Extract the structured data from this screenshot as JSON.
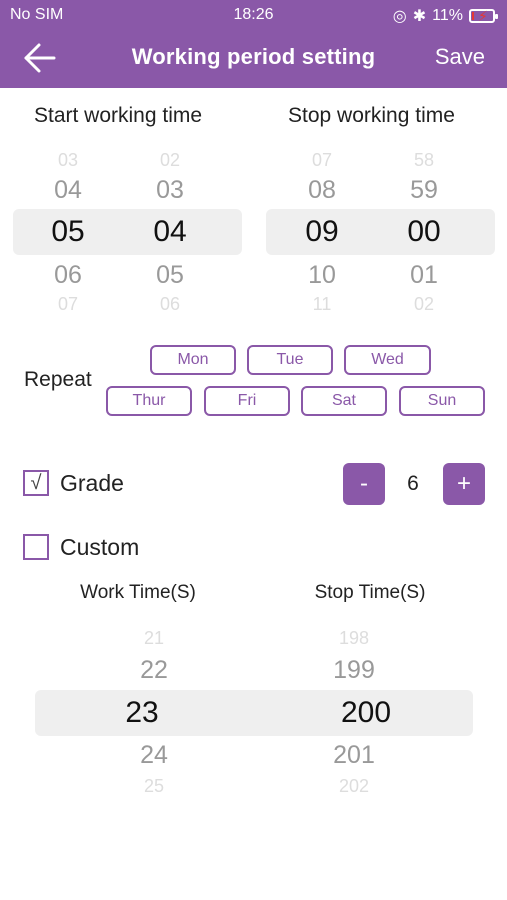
{
  "status_bar": {
    "carrier": "No SIM",
    "time": "18:26",
    "battery": "11%",
    "battery_level": 0.11
  },
  "nav": {
    "title": "Working period setting",
    "save_label": "Save",
    "back_icon": "arrow-left-icon"
  },
  "start_time": {
    "title": "Start working time",
    "hours": {
      "above2": "03",
      "above": "04",
      "selected": "05",
      "below": "06",
      "below2": "07"
    },
    "minutes": {
      "above2": "02",
      "above": "03",
      "selected": "04",
      "below": "05",
      "below2": "06"
    }
  },
  "stop_time": {
    "title": "Stop working time",
    "hours": {
      "above2": "07",
      "above": "08",
      "selected": "09",
      "below": "10",
      "below2": "11"
    },
    "minutes": {
      "above2": "58",
      "above": "59",
      "selected": "00",
      "below": "01",
      "below2": "02"
    }
  },
  "repeat": {
    "label": "Repeat",
    "days": [
      "Mon",
      "Tue",
      "Wed",
      "Thur",
      "Fri",
      "Sat",
      "Sun"
    ]
  },
  "grade": {
    "label": "Grade",
    "checked_mark": "√",
    "minus_label": "-",
    "plus_label": "+",
    "value": "6"
  },
  "custom": {
    "label": "Custom",
    "work_title": "Work Time(S)",
    "stop_title": "Stop Time(S)",
    "work": {
      "above2": "21",
      "above": "22",
      "selected": "23",
      "below": "24",
      "below2": "25"
    },
    "stop": {
      "above2": "198",
      "above": "199",
      "selected": "200",
      "below": "201",
      "below2": "202"
    }
  },
  "colors": {
    "accent": "#8a58a8",
    "band": "#efefef"
  }
}
